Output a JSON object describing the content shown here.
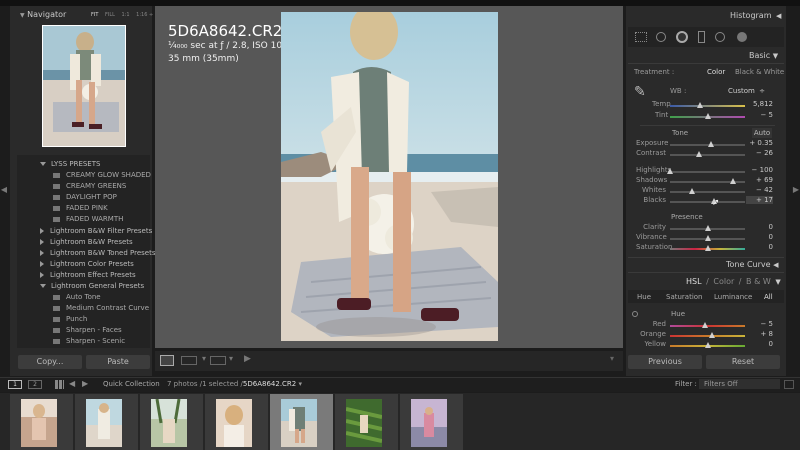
{
  "navigator": {
    "title": "Navigator",
    "zoom_options": [
      "FIT",
      "FILL",
      "1:1",
      "1:16"
    ],
    "zoom_dropdown_arrow": "÷"
  },
  "presets": {
    "group_open": "LYSS PRESETS",
    "group_items": [
      "CREAMY GLOW SHADED",
      "CREAMY GREENS",
      "DAYLIGHT POP",
      "FADED PINK",
      "FADED WARMTH"
    ],
    "collapsed_groups": [
      "Lightroom B&W Filter Presets",
      "Lightroom B&W Presets",
      "Lightroom B&W Toned Presets",
      "Lightroom Color Presets",
      "Lightroom Effect Presets"
    ],
    "general_group": "Lightroom General Presets",
    "general_items": [
      "Auto Tone",
      "Medium Contrast Curve",
      "Punch",
      "Sharpen - Faces",
      "Sharpen - Scenic"
    ]
  },
  "left_buttons": {
    "copy": "Copy...",
    "paste": "Paste"
  },
  "image_info": {
    "filename": "5D6A8642.CR2",
    "exposure_line": "¹⁄₄₀₀₀ sec at ƒ / 2.8, ISO 100",
    "lens_line": "35 mm (35mm)"
  },
  "histogram": {
    "title": "Histogram",
    "collapse_icon": "◀"
  },
  "basic": {
    "title": "Basic",
    "treatment_label": "Treatment :",
    "treatment_color": "Color",
    "treatment_bw": "Black & White",
    "wb_label": "WB :",
    "wb_value": "Custom",
    "wb_dropdown_arrow": "÷",
    "temp": {
      "label": "Temp",
      "value": "5,812"
    },
    "tint": {
      "label": "Tint",
      "value": "− 5"
    },
    "tone_label": "Tone",
    "auto_label": "Auto",
    "exposure": {
      "label": "Exposure",
      "value": "+ 0.35",
      "pos": 0.54
    },
    "contrast": {
      "label": "Contrast",
      "value": "− 26",
      "pos": 0.38
    },
    "highlights": {
      "label": "Highlights",
      "value": "− 100",
      "pos": 0.0
    },
    "shadows": {
      "label": "Shadows",
      "value": "+ 69",
      "pos": 0.84
    },
    "whites": {
      "label": "Whites",
      "value": "− 42",
      "pos": 0.29
    },
    "blacks": {
      "label": "Blacks",
      "value": "+ 17",
      "pos": 0.58
    },
    "presence_label": "Presence",
    "clarity": {
      "label": "Clarity",
      "value": "0",
      "pos": 0.5
    },
    "vibrance": {
      "label": "Vibrance",
      "value": "0",
      "pos": 0.5
    },
    "saturation": {
      "label": "Saturation",
      "value": "0",
      "pos": 0.5
    }
  },
  "tone_curve": {
    "title": "Tone Curve"
  },
  "hsl": {
    "tabs": [
      "HSL",
      "Color",
      "B & W"
    ],
    "subtabs": [
      "Hue",
      "Saturation",
      "Luminance",
      "All"
    ],
    "section": "Hue",
    "red": {
      "label": "Red",
      "value": "− 5",
      "pos": 0.46
    },
    "orange": {
      "label": "Orange",
      "value": "+ 8",
      "pos": 0.56
    },
    "yellow": {
      "label": "Yellow",
      "value": "0",
      "pos": 0.5
    }
  },
  "right_buttons": {
    "previous": "Previous",
    "reset": "Reset"
  },
  "filmstrip_bar": {
    "page1": "1",
    "page2": "2",
    "collection": "Quick Collection",
    "info_prefix": "7 photos /1 selected /",
    "info_file": "5D6A8642.CR2",
    "filter_label": "Filter :",
    "filter_value": "Filters Off"
  },
  "filmstrip": {
    "count": 7,
    "selected_index": 4
  },
  "colors": {
    "panel": "#2a2a2a",
    "background": "#575757",
    "accent": "#cfcfcf"
  }
}
